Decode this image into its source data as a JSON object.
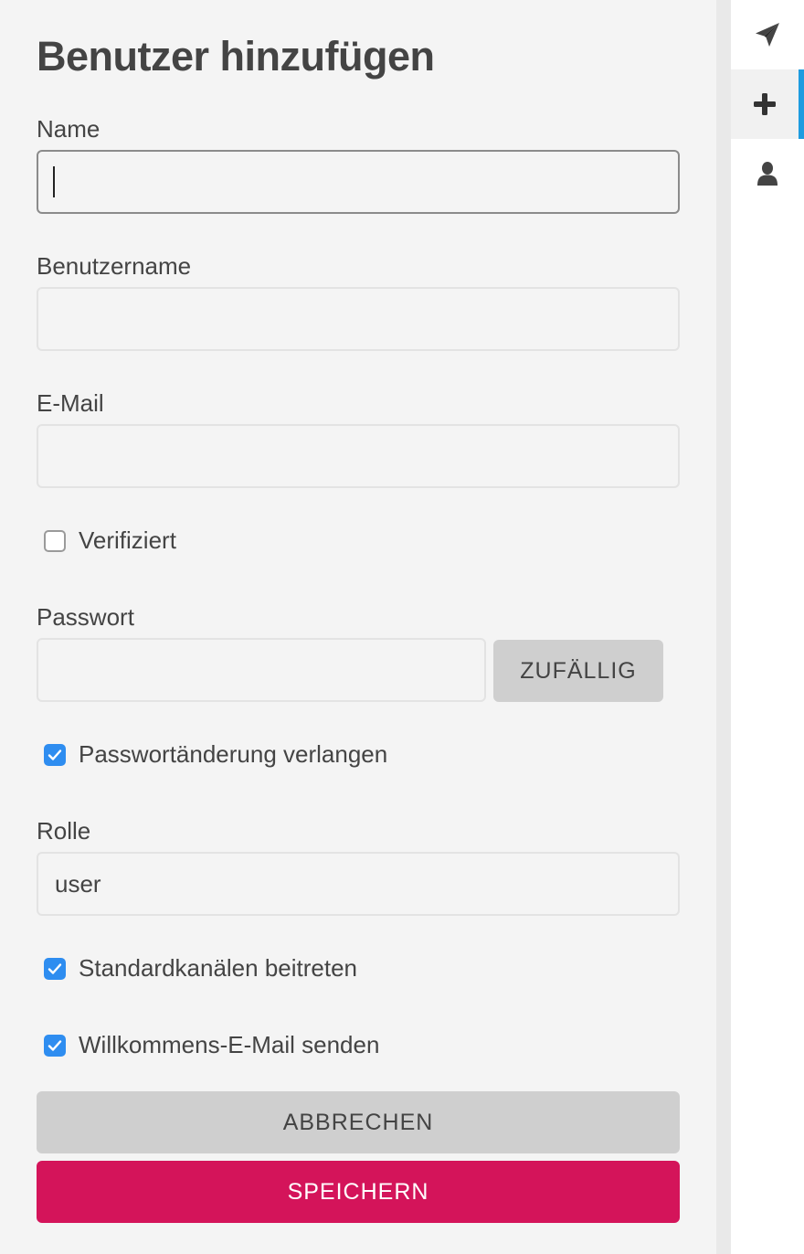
{
  "form": {
    "title": "Benutzer hinzufügen",
    "name": {
      "label": "Name",
      "value": ""
    },
    "username": {
      "label": "Benutzername",
      "value": ""
    },
    "email": {
      "label": "E-Mail",
      "value": ""
    },
    "verified": {
      "label": "Verifiziert",
      "checked": false
    },
    "password": {
      "label": "Passwort",
      "value": "",
      "random_label": "ZUFÄLLIG"
    },
    "require_password_change": {
      "label": "Passwortänderung verlangen",
      "checked": true
    },
    "role": {
      "label": "Rolle",
      "value": "user"
    },
    "join_default_channels": {
      "label": "Standardkanälen beitreten",
      "checked": true
    },
    "send_welcome_email": {
      "label": "Willkommens-E-Mail senden",
      "checked": true
    },
    "cancel_label": "ABBRECHEN",
    "save_label": "SPEICHERN"
  },
  "rail": {
    "items": [
      {
        "icon": "send-icon",
        "active": false
      },
      {
        "icon": "plus-icon",
        "active": true
      },
      {
        "icon": "user-icon",
        "active": false
      }
    ]
  },
  "colors": {
    "primary": "#d4145a",
    "accent": "#1d9ce0",
    "checkbox": "#2e8df0"
  }
}
